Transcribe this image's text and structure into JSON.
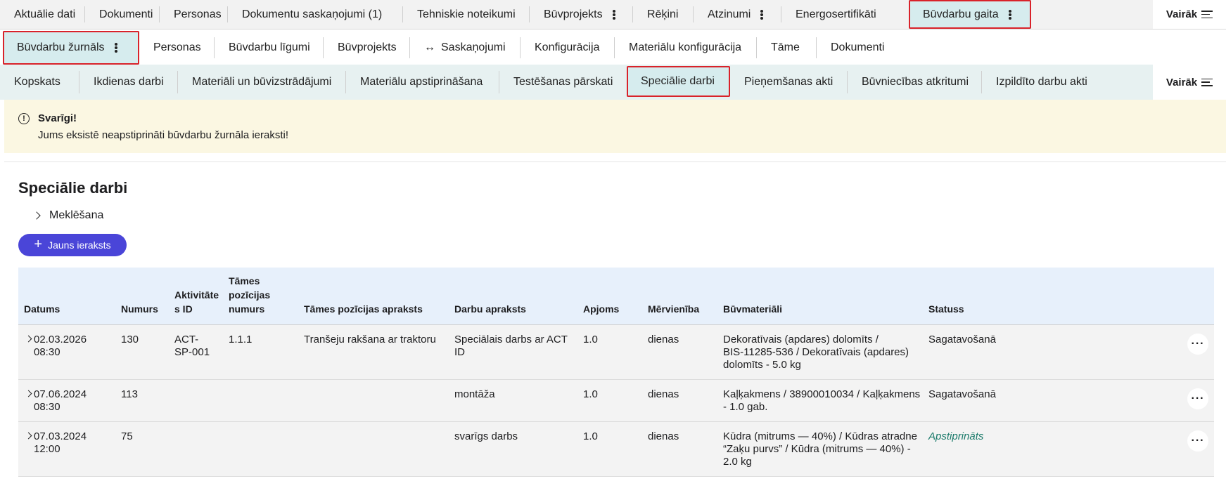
{
  "nav_top": {
    "tabs": [
      {
        "label": "Aktuālie dati"
      },
      {
        "label": "Dokumenti"
      },
      {
        "label": "Personas"
      },
      {
        "label": "Dokumentu saskaņojumi (1)"
      },
      {
        "label": "Tehniskie noteikumi"
      },
      {
        "label": "Būvprojekts"
      },
      {
        "label": "Rēķini"
      },
      {
        "label": "Atzinumi"
      },
      {
        "label": "Energosertifikāti"
      },
      {
        "label": "Būvdarbu gaita"
      }
    ],
    "more_label": "Vairāk"
  },
  "nav_mid": {
    "tabs": [
      {
        "label": "Būvdarbu žurnāls"
      },
      {
        "label": "Personas"
      },
      {
        "label": "Būvdarbu līgumi"
      },
      {
        "label": "Būvprojekts"
      },
      {
        "label": "Saskaņojumi",
        "icon": "↔"
      },
      {
        "label": "Konfigurācija"
      },
      {
        "label": "Materiālu konfigurācija"
      },
      {
        "label": "Tāme"
      },
      {
        "label": "Dokumenti"
      }
    ]
  },
  "nav_sub": {
    "tabs": [
      {
        "label": "Kopskats"
      },
      {
        "label": "Ikdienas darbi"
      },
      {
        "label": "Materiāli un būvizstrādājumi"
      },
      {
        "label": "Materiālu apstiprināšana"
      },
      {
        "label": "Testēšanas pārskati"
      },
      {
        "label": "Speciālie darbi"
      },
      {
        "label": "Pieņemšanas akti"
      },
      {
        "label": "Būvniecības atkritumi"
      },
      {
        "label": "Izpildīto darbu akti"
      }
    ],
    "more_label": "Vairāk"
  },
  "alert": {
    "title": "Svarīgi!",
    "message": "Jums eksistē neapstiprināti būvdarbu žurnāla ieraksti!",
    "icon": "exclamation-circle-icon"
  },
  "page": {
    "title": "Speciālie darbi",
    "search_label": "Meklēšana",
    "new_button_label": "Jauns ieraksts"
  },
  "table": {
    "columns": {
      "datums": "Datums",
      "numurs": "Numurs",
      "aktivitate": [
        "Aktivitāte",
        "s ID"
      ],
      "tames_nr": [
        "Tāmes",
        "pozīcijas",
        "numurs"
      ],
      "tames_apraksts": "Tāmes pozīcijas apraksts",
      "darbu_apraksts": "Darbu apraksts",
      "apjoms": "Apjoms",
      "mervieniba": "Mērvienība",
      "buvmateriali": "Būvmateriāli",
      "statuss": "Statuss"
    },
    "rows": [
      {
        "date": "02.03.2026",
        "time": "08:30",
        "numurs": "130",
        "aktivitate": [
          "ACT-",
          "SP-001"
        ],
        "tames_nr": "1.1.1",
        "tames_apraksts": "Tranšeju rakšana ar traktoru",
        "darbu_apraksts": [
          "Speciālais darbs ar ACT",
          "ID"
        ],
        "apjoms": "1.0",
        "mervieniba": "dienas",
        "buvmateriali": [
          "Dekoratīvais (apdares) dolomīts /",
          "BIS-11285-536 / Dekoratīvais (apdares)",
          "dolomīts - 5.0 kg"
        ],
        "statuss": "Sagatavošanā"
      },
      {
        "date": "07.06.2024",
        "time": "08:30",
        "numurs": "113",
        "aktivitate": [
          "",
          ""
        ],
        "tames_nr": "",
        "tames_apraksts": "",
        "darbu_apraksts": [
          "montāža",
          ""
        ],
        "apjoms": "1.0",
        "mervieniba": "dienas",
        "buvmateriali": [
          "Kaļķakmens / 38900010034 / Kaļķakmens",
          "- 1.0 gab.",
          ""
        ],
        "statuss": "Sagatavošanā"
      },
      {
        "date": "07.03.2024",
        "time": "12:00",
        "numurs": "75",
        "aktivitate": [
          "",
          ""
        ],
        "tames_nr": "",
        "tames_apraksts": "",
        "darbu_apraksts": [
          "svarīgs darbs",
          ""
        ],
        "apjoms": "1.0",
        "mervieniba": "dienas",
        "buvmateriali": [
          "Kūdra (mitrums — 40%) / Kūdras atradne",
          "“Zaķu purvs” / Kūdra (mitrums — 40%) -",
          "2.0 kg"
        ],
        "statuss": "Apstiprināts"
      }
    ]
  },
  "colors": {
    "primary_button": "#4a45d8",
    "active_tab": "#d6ecee",
    "highlight_outline": "#d9222a",
    "alert_bg": "#fbf7e2",
    "approved_status": "#1a7a6a"
  }
}
